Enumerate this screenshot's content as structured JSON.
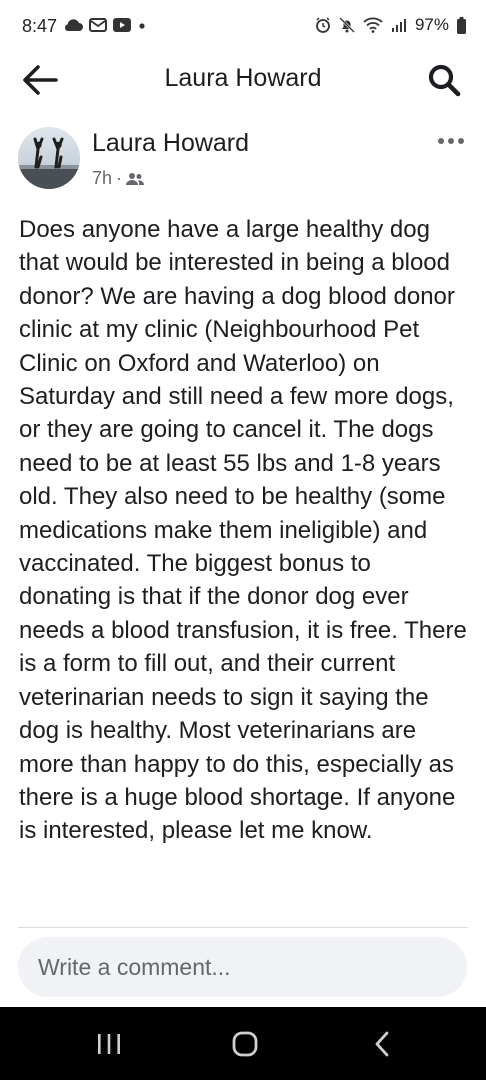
{
  "status_bar": {
    "time": "8:47",
    "battery": "97%",
    "left_icons": [
      "cloud-icon",
      "mail-icon",
      "video-icon",
      "dot-icon"
    ],
    "right_icons": [
      "alarm-icon",
      "silent-icon",
      "wifi-icon",
      "signal-icon",
      "battery-icon"
    ]
  },
  "header": {
    "title": "Laura Howard",
    "back_icon": "arrow-left-icon",
    "search_icon": "search-icon"
  },
  "post": {
    "author": "Laura Howard",
    "time": "7h",
    "separator": "·",
    "privacy_icon": "friends-icon",
    "text": "Does anyone have a large healthy dog that would be interested in being a blood donor? We are having a dog blood donor clinic at my clinic (Neighbourhood Pet Clinic on Oxford and Waterloo) on Saturday and still need a few more dogs, or they are going to cancel it. The dogs need to be at least 55 lbs and 1-8  years old. They also need to be healthy (some medications make them ineligible) and vaccinated. The biggest bonus to donating is that if the donor dog ever needs a blood transfusion, it is free. There is a form to fill out, and their current veterinarian needs to sign it saying the dog is healthy. Most veterinarians are more than happy to do this, especially as there is a huge blood shortage. If anyone is interested, please let me know."
  },
  "comment": {
    "placeholder": "Write a comment..."
  },
  "nav_bar": {
    "buttons": [
      "recents-icon",
      "home-icon",
      "back-icon"
    ]
  },
  "colors": {
    "text": "#1c1e21",
    "secondary_text": "#65676b",
    "comment_bg": "#f0f2f5",
    "navbar_bg": "#000000"
  }
}
